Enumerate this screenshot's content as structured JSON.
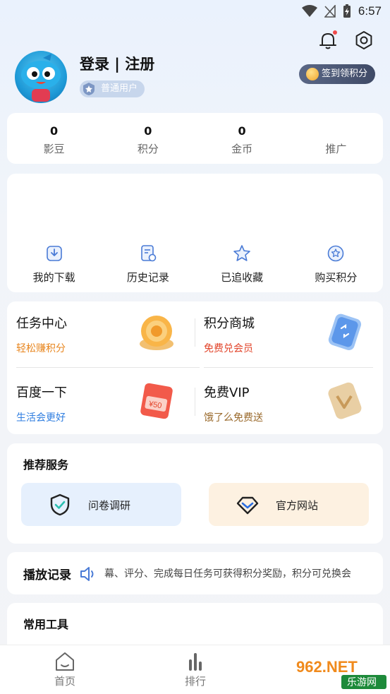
{
  "status": {
    "time": "6:57"
  },
  "header": {
    "username": "登录 | 注册",
    "badge": "普通用户",
    "checkin": "签到领积分"
  },
  "stats": [
    {
      "value": "0",
      "label": "影豆"
    },
    {
      "value": "0",
      "label": "积分"
    },
    {
      "value": "0",
      "label": "金币"
    },
    {
      "value": "",
      "label": "推广"
    }
  ],
  "quick": [
    {
      "label": "我的下载",
      "icon": "download-icon"
    },
    {
      "label": "历史记录",
      "icon": "history-icon"
    },
    {
      "label": "已追收藏",
      "icon": "star-icon"
    },
    {
      "label": "购买积分",
      "icon": "star-circle-icon"
    }
  ],
  "features": [
    {
      "title": "任务中心",
      "subtitle": "轻松赚积分",
      "color": "#e8861f"
    },
    {
      "title": "积分商城",
      "subtitle": "免费兑会员",
      "color": "#e2452b"
    },
    {
      "title": "百度一下",
      "subtitle": "生活会更好",
      "color": "#2f7ee0"
    },
    {
      "title": "免费VIP",
      "subtitle": "饿了么免费送",
      "color": "#9a6a2c"
    }
  ],
  "recommend": {
    "title": "推荐服务",
    "items": [
      {
        "label": "问卷调研",
        "bg": "#e6f0fd"
      },
      {
        "label": "官方网站",
        "bg": "#fdf1e1"
      }
    ]
  },
  "history": {
    "title": "播放记录",
    "marquee": "幕、评分、完成每日任务可获得积分奖励，积分可兑换会"
  },
  "tools": {
    "title": "常用工具"
  },
  "nav": [
    {
      "label": "首页"
    },
    {
      "label": "排行"
    }
  ],
  "watermark": {
    "site": "962.NET",
    "name": "乐游网"
  }
}
